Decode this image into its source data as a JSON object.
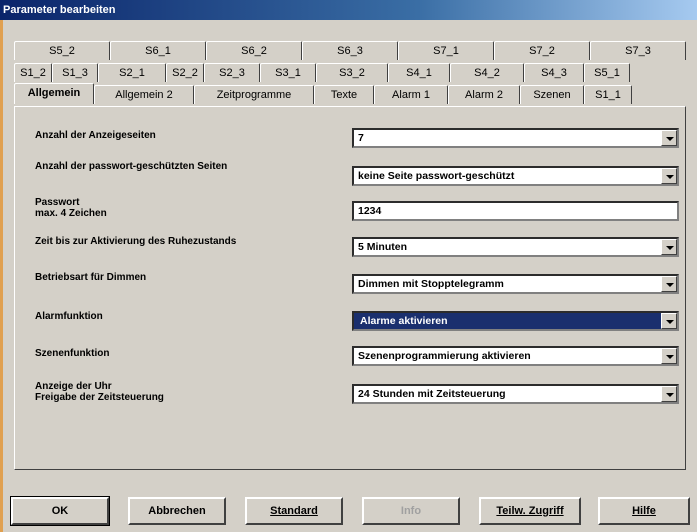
{
  "window": {
    "title": "Parameter bearbeiten"
  },
  "tabs": {
    "row1": [
      "S5_2",
      "S6_1",
      "S6_2",
      "S6_3",
      "S7_1",
      "S7_2",
      "S7_3"
    ],
    "row2": [
      "S1_2",
      "S1_3",
      "S2_1",
      "S2_2",
      "S2_3",
      "S3_1",
      "S3_2",
      "S4_1",
      "S4_2",
      "S4_3",
      "S5_1"
    ],
    "row3": [
      "Allgemein",
      "Allgemein 2",
      "Zeitprogramme",
      "Texte",
      "Alarm 1",
      "Alarm 2",
      "Szenen",
      "S1_1"
    ],
    "active": "Allgemein"
  },
  "form": {
    "anzahl_label": "Anzahl der Anzeigeseiten",
    "anzahl_value": "7",
    "pw_pages_label": "Anzahl der passwort-geschützten Seiten",
    "pw_pages_value": "keine Seite passwort-geschützt",
    "password_label": "Passwort",
    "password_sub": "max. 4 Zeichen",
    "password_value": "1234",
    "ruhe_label": "Zeit bis zur Aktivierung des Ruhezustands",
    "ruhe_value": "5 Minuten",
    "dimmen_label": "Betriebsart für Dimmen",
    "dimmen_value": "Dimmen mit Stopptelegramm",
    "alarm_label": "Alarmfunktion",
    "alarm_value": "Alarme aktivieren",
    "szenen_label": "Szenenfunktion",
    "szenen_value": "Szenenprogrammierung aktivieren",
    "uhr_label": "Anzeige der Uhr",
    "uhr_sub": "Freigabe der Zeitsteuerung",
    "uhr_value": "24 Stunden mit Zeitsteuerung"
  },
  "buttons": {
    "ok": "OK",
    "cancel": "Abbrechen",
    "standard": "Standard",
    "info": "Info",
    "zugriff": "Teilw. Zugriff",
    "help": "Hilfe"
  }
}
